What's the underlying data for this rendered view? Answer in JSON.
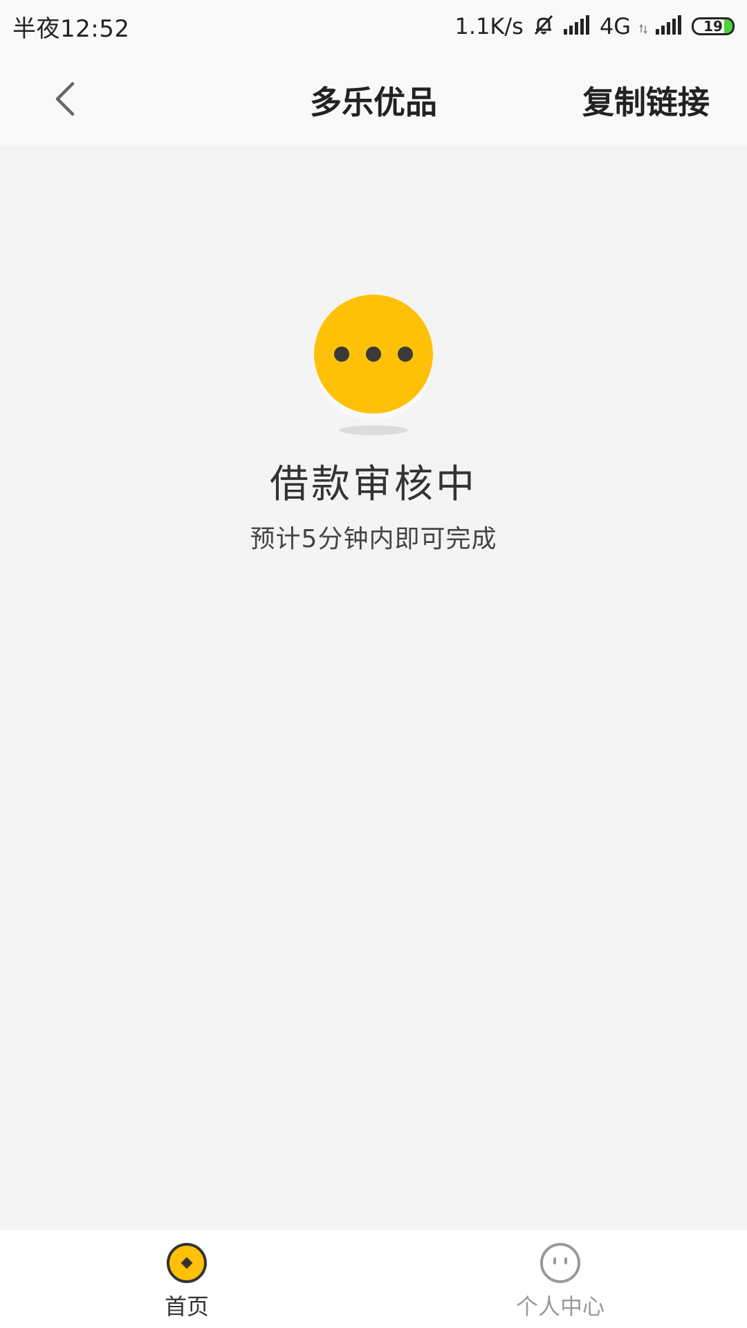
{
  "status_bar": {
    "time": "半夜12:52",
    "net_speed": "1.1K/s",
    "network_type": "4G",
    "battery_level": "19",
    "icons": [
      "bell-muted-icon",
      "signal-icon",
      "data-arrows-icon",
      "signal-icon",
      "battery-icon"
    ]
  },
  "header": {
    "title": "多乐优品",
    "copy_link_label": "复制链接",
    "back_icon": "chevron-left-icon"
  },
  "main": {
    "status_icon": "pending-dots-icon",
    "title": "借款审核中",
    "subtitle": "预计5分钟内即可完成"
  },
  "bottom_nav": {
    "items": [
      {
        "label": "首页",
        "icon": "coin-home-icon",
        "active": true
      },
      {
        "label": "个人中心",
        "icon": "face-profile-icon",
        "active": false
      }
    ]
  },
  "colors": {
    "accent": "#FFC107",
    "background": "#F4F4F4",
    "bar": "#F9F9F9",
    "battery_green": "#4CD137"
  }
}
